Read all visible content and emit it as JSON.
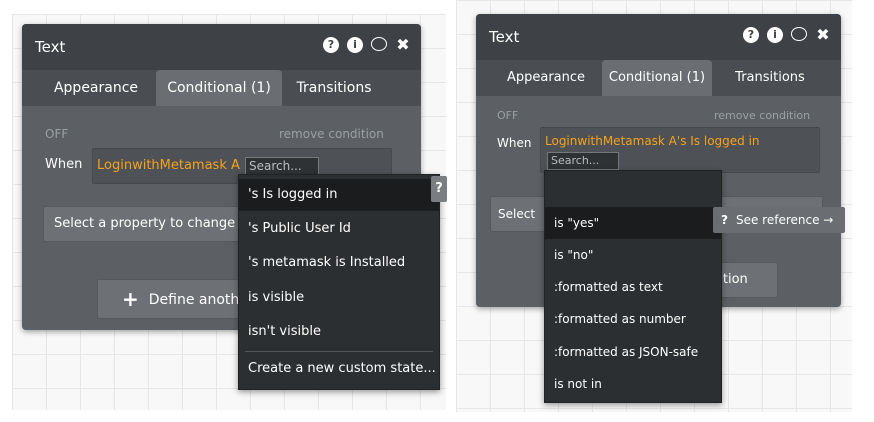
{
  "left": {
    "title": "Text",
    "tabs": [
      "Appearance",
      "Conditional (1)",
      "Transitions"
    ],
    "off": "OFF",
    "remove": "remove condition",
    "when": "When",
    "expression": "LoginwithMetamask A",
    "search_placeholder": "Search...",
    "property": "Select a property to change w",
    "define": "Define anoth",
    "dropdown": [
      "'s Is logged in",
      "'s Public User Id",
      "'s metamask is Installed",
      "is visible",
      "isn't visible",
      "Create a new custom state..."
    ],
    "help_badge": "?"
  },
  "right": {
    "title": "Text",
    "tabs": [
      "Appearance",
      "Conditional (1)",
      "Transitions"
    ],
    "off": "OFF",
    "remove": "remove condition",
    "when": "When",
    "expression": "LoginwithMetamask A's Is logged in",
    "search_placeholder": "Search...",
    "select": "Select",
    "condition_btn": "dition",
    "dropdown": [
      "is \"yes\"",
      "is \"no\"",
      ":formatted as text",
      ":formatted as number",
      ":formatted as JSON-safe",
      "is not in"
    ],
    "see_reference": "See reference →",
    "help_badge": "?"
  }
}
